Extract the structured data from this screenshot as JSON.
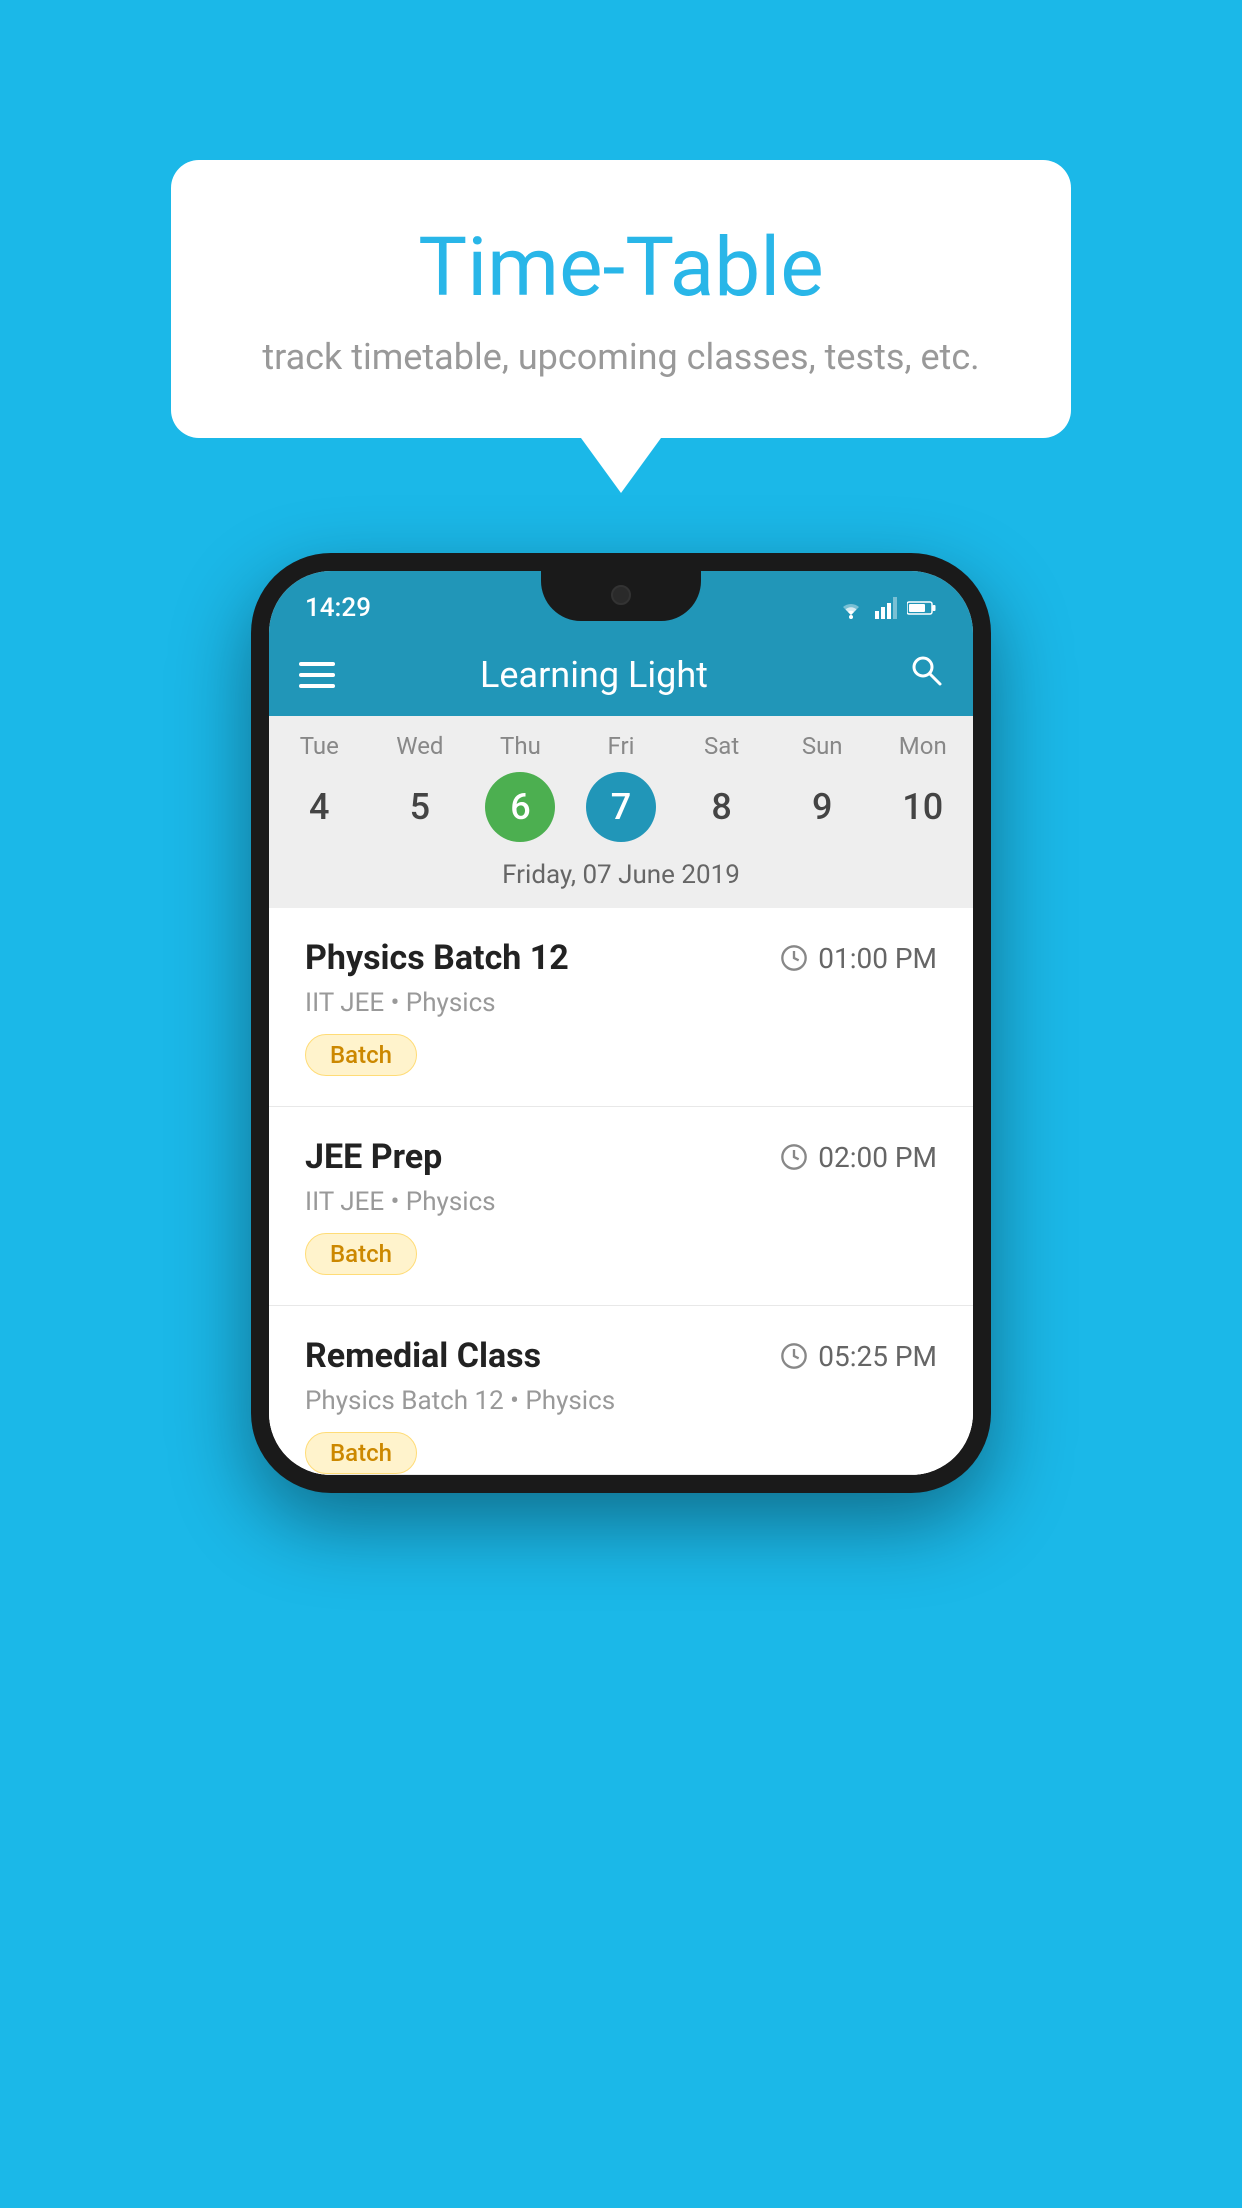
{
  "background_color": "#1BB8E8",
  "speech_bubble": {
    "title": "Time-Table",
    "subtitle": "track timetable, upcoming classes, tests, etc."
  },
  "status_bar": {
    "time": "14:29"
  },
  "app_bar": {
    "title": "Learning Light"
  },
  "calendar": {
    "selected_date_label": "Friday, 07 June 2019",
    "days": [
      {
        "label": "Tue",
        "num": "4",
        "state": "normal"
      },
      {
        "label": "Wed",
        "num": "5",
        "state": "normal"
      },
      {
        "label": "Thu",
        "num": "6",
        "state": "today"
      },
      {
        "label": "Fri",
        "num": "7",
        "state": "selected"
      },
      {
        "label": "Sat",
        "num": "8",
        "state": "normal"
      },
      {
        "label": "Sun",
        "num": "9",
        "state": "normal"
      },
      {
        "label": "Mon",
        "num": "10",
        "state": "normal"
      }
    ]
  },
  "events": [
    {
      "name": "Physics Batch 12",
      "time": "01:00 PM",
      "meta": "IIT JEE • Physics",
      "tag": "Batch"
    },
    {
      "name": "JEE Prep",
      "time": "02:00 PM",
      "meta": "IIT JEE • Physics",
      "tag": "Batch"
    },
    {
      "name": "Remedial Class",
      "time": "05:25 PM",
      "meta": "Physics Batch 12 • Physics",
      "tag": "Batch"
    }
  ]
}
